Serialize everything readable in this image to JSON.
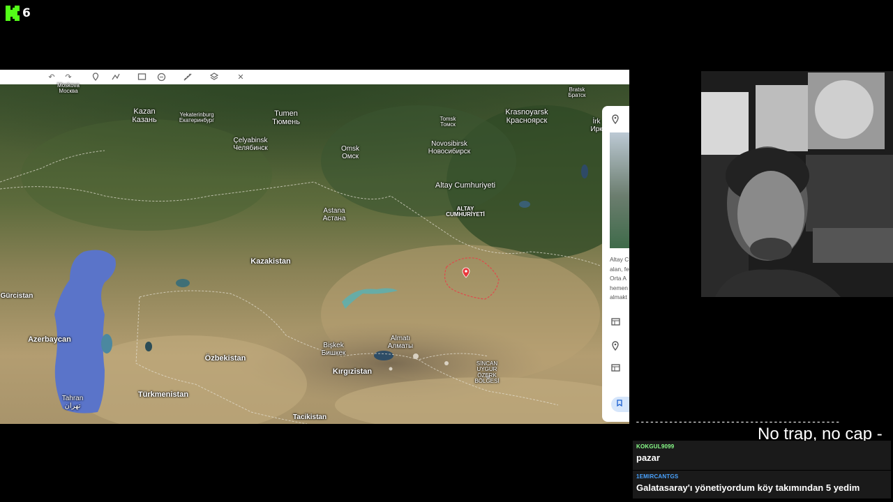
{
  "stream": {
    "viewer_count": "6",
    "logo_icon": "kick-logo-icon",
    "accent": "#53fc18"
  },
  "map": {
    "toolbar_icons": [
      "undo-icon",
      "redo-icon",
      "pin-icon",
      "path-icon",
      "layers-icon",
      "measure-icon",
      "ruler-icon",
      "stack-icon",
      "close-icon"
    ],
    "marker_label": "ALTAY CUMHURİYETİ",
    "places": {
      "moskova": {
        "a": "Moskova",
        "b": "Москва"
      },
      "kazan": {
        "a": "Kazan",
        "b": "Казань"
      },
      "yekaterinburg": {
        "a": "Yekaterinburg",
        "b": "Екатеринбург"
      },
      "tumen": {
        "a": "Tumen",
        "b": "Тюмень"
      },
      "celyabinsk": {
        "a": "Çelyabinsk",
        "b": "Челябинск"
      },
      "omsk": {
        "a": "Omsk",
        "b": "Омск"
      },
      "tomsk": {
        "a": "Tomsk",
        "b": "Томск"
      },
      "novosibirsk": {
        "a": "Novosibirsk",
        "b": "Новосибирск"
      },
      "krasnoyarsk": {
        "a": "Krasnoyarsk",
        "b": "Красноярск"
      },
      "bratsk": {
        "a": "Bratsk",
        "b": "Братск"
      },
      "irk": {
        "a": "İrk",
        "b": "Ирк"
      },
      "altay": {
        "a": "Altay Cumhuriyeti"
      },
      "astana": {
        "a": "Astana",
        "b": "Астана"
      },
      "kazakistan": {
        "a": "Kazakistan"
      },
      "gurcistan": {
        "a": "Gürcistan"
      },
      "azerbaycan": {
        "a": "Azerbaycan"
      },
      "ozbekistan": {
        "a": "Özbekistan"
      },
      "turkmenistan": {
        "a": "Türkmenistan"
      },
      "tahran": {
        "a": "Tahran",
        "b": "تهران"
      },
      "biskek": {
        "a": "Bişkek",
        "b": "Бишкек"
      },
      "almati": {
        "a": "Almatı",
        "b": "Алматы"
      },
      "kirgizistan": {
        "a": "Kırgızistan"
      },
      "tacikistan": {
        "a": "Tacikistan"
      },
      "sincan": {
        "a": "SİNCAN",
        "b": "UYGUR",
        "c": "ÖZERK",
        "d": "BÖLGESİ"
      }
    },
    "panel": {
      "text_lines": [
        "Altay C",
        "alan, fe",
        "Orta A",
        "hemen",
        "almakt"
      ],
      "icons": [
        "location-pin-icon",
        "reader-mode-icon",
        "location-pin-icon",
        "reader-mode-icon",
        "bookmark-icon"
      ]
    }
  },
  "chat": {
    "ticker": "No trap, no cap -",
    "messages": [
      {
        "user": "KOKGUL9099",
        "text": "pazar",
        "color": "#8aff8a"
      },
      {
        "user": "1EMIRCANTGS",
        "text": "Galatasaray'ı yönetiyordum köy takımından 5 yedim",
        "color": "#4aa3ff"
      }
    ]
  }
}
